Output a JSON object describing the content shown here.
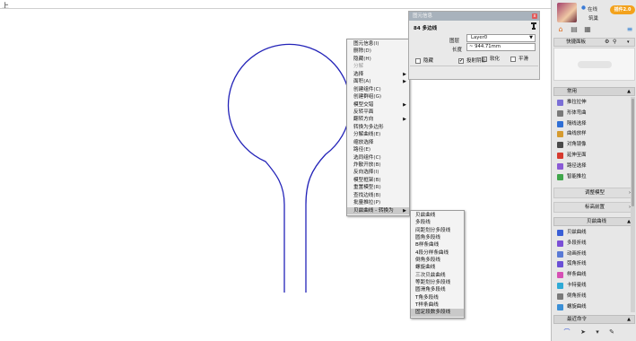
{
  "viewport_label": "上",
  "context_menu": {
    "items": [
      {
        "label": "图元信息",
        "shortcut": "(I)",
        "arrow": false,
        "disabled": false,
        "highlight": false
      },
      {
        "label": "删除",
        "shortcut": "(D)",
        "arrow": false,
        "disabled": false,
        "highlight": false
      },
      {
        "label": "隐藏",
        "shortcut": "(H)",
        "arrow": false,
        "disabled": false,
        "highlight": false
      },
      {
        "label": "分解",
        "shortcut": "",
        "arrow": false,
        "disabled": true,
        "highlight": false
      },
      {
        "label": "选择",
        "shortcut": "",
        "arrow": true,
        "disabled": false,
        "highlight": false
      },
      {
        "label": "面积",
        "shortcut": "(A)",
        "arrow": true,
        "disabled": false,
        "highlight": false
      },
      {
        "label": "创建组件",
        "shortcut": "(C)",
        "arrow": false,
        "disabled": false,
        "highlight": false
      },
      {
        "label": "创建群组",
        "shortcut": "(G)",
        "arrow": false,
        "disabled": false,
        "highlight": false
      },
      {
        "label": "模型交错",
        "shortcut": "",
        "arrow": true,
        "disabled": false,
        "highlight": false
      },
      {
        "label": "反转平面",
        "shortcut": "",
        "arrow": false,
        "disabled": false,
        "highlight": false
      },
      {
        "label": "翻转方向",
        "shortcut": "",
        "arrow": true,
        "disabled": false,
        "highlight": false
      },
      {
        "label": "转换为多边形",
        "shortcut": "",
        "arrow": false,
        "disabled": false,
        "highlight": false
      },
      {
        "label": "分解曲线",
        "shortcut": "(E)",
        "arrow": false,
        "disabled": false,
        "highlight": false
      },
      {
        "label": "缩放选择",
        "shortcut": "",
        "arrow": false,
        "disabled": false,
        "highlight": false
      },
      {
        "label": "路径",
        "shortcut": "(E)",
        "arrow": false,
        "disabled": false,
        "highlight": false
      },
      {
        "label": "选同组件",
        "shortcut": "(C)",
        "arrow": false,
        "disabled": false,
        "highlight": false
      },
      {
        "label": "炸散开放",
        "shortcut": "(B)",
        "arrow": false,
        "disabled": false,
        "highlight": false
      },
      {
        "label": "反向选择",
        "shortcut": "(I)",
        "arrow": false,
        "disabled": false,
        "highlight": false
      },
      {
        "label": "模型框架",
        "shortcut": "(B)",
        "arrow": false,
        "disabled": false,
        "highlight": false
      },
      {
        "label": "重置模型",
        "shortcut": "(R)",
        "arrow": false,
        "disabled": false,
        "highlight": false
      },
      {
        "label": "查找边线",
        "shortcut": "(B)",
        "arrow": false,
        "disabled": false,
        "highlight": false
      },
      {
        "label": "批量推拉",
        "shortcut": "(P)",
        "arrow": false,
        "disabled": false,
        "highlight": false
      },
      {
        "label": "贝兹曲线 - 转换为",
        "shortcut": "",
        "arrow": true,
        "disabled": false,
        "highlight": true
      }
    ]
  },
  "submenu": {
    "items": [
      {
        "label": "贝兹曲线",
        "highlight": false
      },
      {
        "label": "多段线",
        "highlight": false
      },
      {
        "label": "间距划分多段线",
        "highlight": false
      },
      {
        "label": "圆角多段线",
        "highlight": false
      },
      {
        "label": "B样条曲线",
        "highlight": false
      },
      {
        "label": "4段分样条曲线",
        "highlight": false
      },
      {
        "label": "倒角多段线",
        "highlight": false
      },
      {
        "label": "螺旋曲线",
        "highlight": false
      },
      {
        "label": "三次贝兹曲线",
        "highlight": false
      },
      {
        "label": "等距划分多段线",
        "highlight": false
      },
      {
        "label": "圆滑角多段线",
        "highlight": false
      },
      {
        "label": "T角多段线",
        "highlight": false
      },
      {
        "label": "T样条曲线",
        "highlight": false
      },
      {
        "label": "固定段数多段线",
        "highlight": true
      }
    ]
  },
  "properties_panel": {
    "title": "图元信息",
    "close": "x",
    "entity_type": "84 多边线",
    "layer_label": "图层",
    "layer_value": "Layer0",
    "length_label": "长度",
    "length_value": "~ 944.71mm",
    "soften_label": "软化",
    "smooth_label": "平滑",
    "hidden_label": "隐藏",
    "cast_shadow_label": "投射阴影",
    "soften_checked": false,
    "smooth_checked": false,
    "hidden_checked": false,
    "cast_shadow_checked": true
  },
  "sidebar": {
    "user_status": "在线",
    "user_name": "筑巢",
    "badge": "插件2.0",
    "quick_panel_label": "快捷面板",
    "common_label": "常用",
    "tools": [
      {
        "label": "推拉拉伸",
        "color": "#7b6fd6"
      },
      {
        "label": "形体弯曲",
        "color": "#7a7a7a"
      },
      {
        "label": "隔线选择",
        "color": "#2f6fd6"
      },
      {
        "label": "曲线放样",
        "color": "#d69b2f"
      },
      {
        "label": "对角镜像",
        "color": "#4a4a4a"
      },
      {
        "label": "延伸至面",
        "color": "#d63a2f"
      },
      {
        "label": "路径选择",
        "color": "#8a5ad6"
      },
      {
        "label": "智能推拉",
        "color": "#3fa64a"
      }
    ],
    "sections": [
      "调整模型",
      "标高前置"
    ],
    "curve_section": "贝兹曲线",
    "curve_tools": [
      {
        "label": "贝兹曲线",
        "color": "#3a5fd6"
      },
      {
        "label": "多段折线",
        "color": "#7b4fd6"
      },
      {
        "label": "动画折线",
        "color": "#5a7ad6"
      },
      {
        "label": "弧角折线",
        "color": "#6a4fd6"
      },
      {
        "label": "样条曲线",
        "color": "#d64fb4"
      },
      {
        "label": "卡特曼线",
        "color": "#2faad6"
      },
      {
        "label": "倒角折线",
        "color": "#7a7a7a"
      },
      {
        "label": "螺旋曲线",
        "color": "#3a8fd6"
      }
    ],
    "recent_label": "最近命令"
  },
  "colors": {
    "curve": "#2323b8",
    "menu_highlight": "#c9c9c9",
    "badge": "#f3a21c",
    "panel_title": "#a8b2bc"
  }
}
